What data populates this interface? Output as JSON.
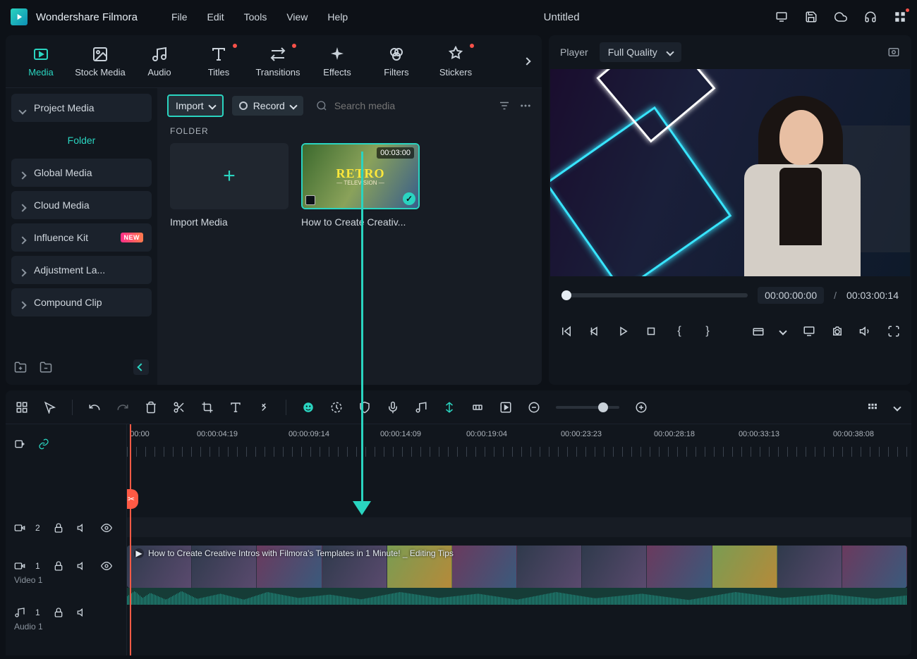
{
  "app_name": "Wondershare Filmora",
  "menus": [
    "File",
    "Edit",
    "Tools",
    "View",
    "Help"
  ],
  "project_title": "Untitled",
  "tabs": [
    {
      "label": "Media",
      "active": true,
      "dot": false
    },
    {
      "label": "Stock Media",
      "active": false,
      "dot": false
    },
    {
      "label": "Audio",
      "active": false,
      "dot": false
    },
    {
      "label": "Titles",
      "active": false,
      "dot": true
    },
    {
      "label": "Transitions",
      "active": false,
      "dot": true
    },
    {
      "label": "Effects",
      "active": false,
      "dot": false
    },
    {
      "label": "Filters",
      "active": false,
      "dot": false
    },
    {
      "label": "Stickers",
      "active": false,
      "dot": true
    }
  ],
  "sidebar": {
    "project_media": "Project Media",
    "folder": "Folder",
    "items": [
      "Global Media",
      "Cloud Media",
      "Influence Kit",
      "Adjustment La...",
      "Compound Clip"
    ],
    "new_badge": "NEW"
  },
  "browser": {
    "import": "Import",
    "record": "Record",
    "search_placeholder": "Search media",
    "folder_label": "FOLDER",
    "import_media": "Import Media",
    "clip_name": "How to Create Creativ...",
    "clip_duration": "00:03:00"
  },
  "player": {
    "label": "Player",
    "quality": "Full Quality",
    "current": "00:00:00:00",
    "total": "00:03:00:14",
    "sep": "/"
  },
  "ruler": [
    "00:00",
    "00:00:04:19",
    "00:00:09:14",
    "00:00:14:09",
    "00:00:19:04",
    "00:00:23:23",
    "00:00:28:18",
    "00:00:33:13",
    "00:00:38:08"
  ],
  "tracks": {
    "v2": "2",
    "v1": "1",
    "video1_label": "Video 1",
    "a1": "1",
    "audio1_label": "Audio 1",
    "clip_title": "How to Create Creative Intros with Filmora's Templates in 1 Minute! _ Editing Tips"
  }
}
